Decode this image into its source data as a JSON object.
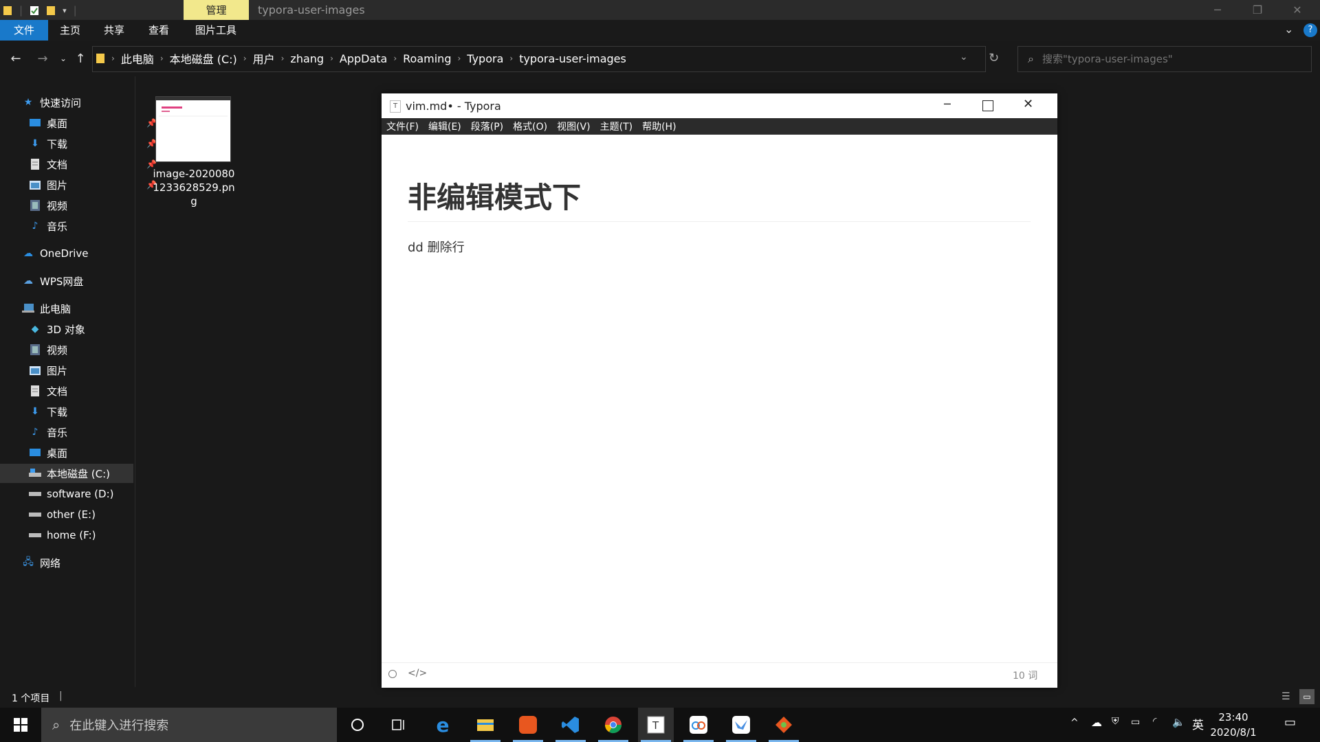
{
  "explorer": {
    "title": "typora-user-images",
    "context_tab": "管理",
    "ribbon_tabs": [
      "文件",
      "主页",
      "共享",
      "查看",
      "图片工具"
    ],
    "breadcrumb": [
      "此电脑",
      "本地磁盘 (C:)",
      "用户",
      "zhang",
      "AppData",
      "Roaming",
      "Typora",
      "typora-user-images"
    ],
    "search_placeholder": "搜索\"typora-user-images\"",
    "sidebar": {
      "quick_access": "快速访问",
      "quick_items": [
        "桌面",
        "下载",
        "文档",
        "图片",
        "视频",
        "音乐"
      ],
      "onedrive": "OneDrive",
      "wps": "WPS网盘",
      "this_pc": "此电脑",
      "pc_items": [
        "3D 对象",
        "视频",
        "图片",
        "文档",
        "下载",
        "音乐",
        "桌面",
        "本地磁盘 (C:)",
        "software (D:)",
        "other (E:)",
        "home (F:)"
      ],
      "network": "网络"
    },
    "file": {
      "name": "image-20200801233628529.png"
    },
    "status": "1 个项目"
  },
  "typora": {
    "title": "vim.md• - Typora",
    "menu": [
      "文件(F)",
      "编辑(E)",
      "段落(P)",
      "格式(O)",
      "视图(V)",
      "主题(T)",
      "帮助(H)"
    ],
    "heading": "非编辑模式下",
    "paragraph": "dd 删除行",
    "word_count": "10 词"
  },
  "taskbar": {
    "search_placeholder": "在此键入进行搜索",
    "ime": "英",
    "time": "23:40",
    "date": "2020/8/1"
  },
  "colors": {
    "accent": "#1979ca",
    "context_tab": "#f2e88c"
  }
}
